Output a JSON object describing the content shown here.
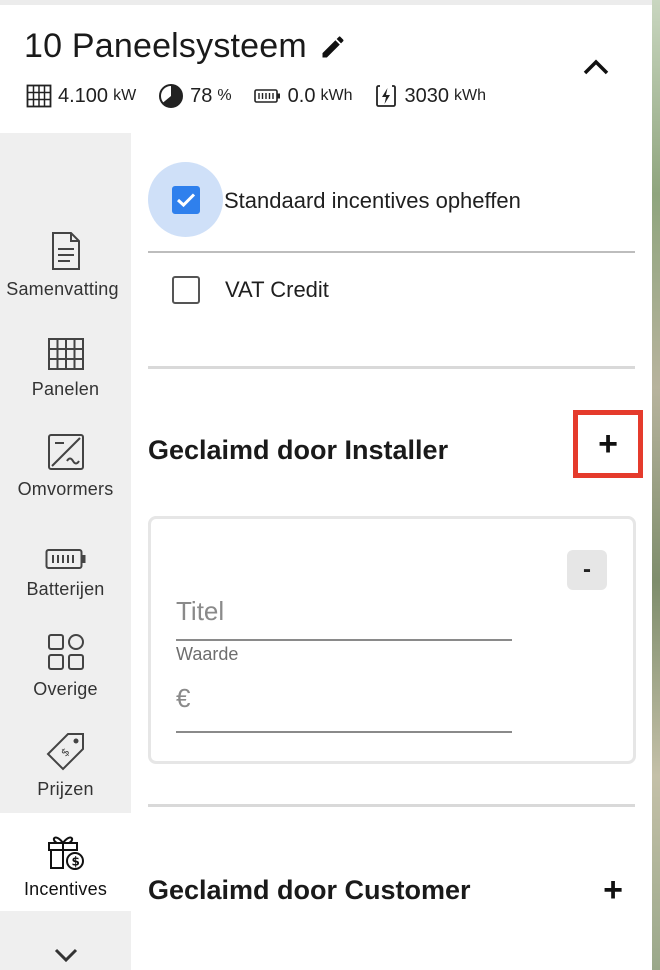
{
  "header": {
    "title": "10 Paneelsysteem",
    "stats": [
      {
        "icon": "panel-grid-icon",
        "value": "4.100",
        "unit": "kW"
      },
      {
        "icon": "percentage-pie-icon",
        "value": "78",
        "unit": "%"
      },
      {
        "icon": "battery-icon",
        "value": "0.0",
        "unit": "kWh"
      },
      {
        "icon": "energy-bolt-icon",
        "value": "3030",
        "unit": "kWh"
      }
    ]
  },
  "sidebar": {
    "items": [
      {
        "label": "Samenvatting",
        "icon": "document-icon",
        "active": false
      },
      {
        "label": "Panelen",
        "icon": "panel-grid-icon",
        "active": false
      },
      {
        "label": "Omvormers",
        "icon": "inverter-icon",
        "active": false
      },
      {
        "label": "Batterijen",
        "icon": "battery-icon",
        "active": false
      },
      {
        "label": "Overige",
        "icon": "widgets-icon",
        "active": false
      },
      {
        "label": "Prijzen",
        "icon": "price-tag-icon",
        "active": false
      },
      {
        "label": "Incentives",
        "icon": "gift-dollar-icon",
        "active": true
      }
    ]
  },
  "main": {
    "override_label": "Standaard incentives opheffen",
    "override_checked": true,
    "vat_label": "VAT Credit",
    "vat_checked": false,
    "installer_section": {
      "title": "Geclaimd door Installer",
      "add_label": "+",
      "card": {
        "remove_label": "-",
        "title_placeholder": "Titel",
        "value_caption": "Waarde",
        "value_placeholder": "€"
      }
    },
    "customer_section": {
      "title": "Geclaimd door Customer",
      "add_label": "+"
    }
  },
  "colors": {
    "accent": "#2f80ed",
    "ripple": "#cfe0f8",
    "highlight_border": "#e53b2c",
    "sidebar_bg": "#efefef"
  }
}
